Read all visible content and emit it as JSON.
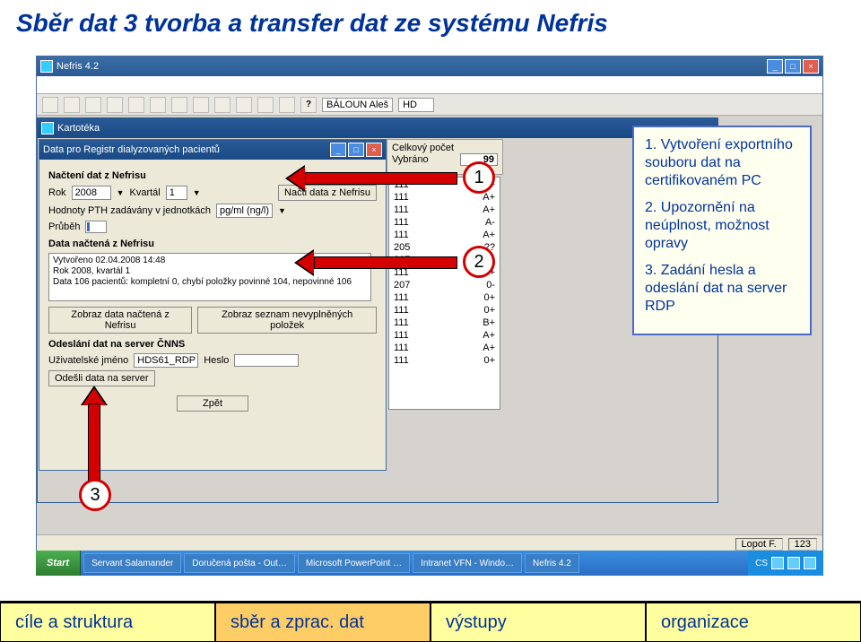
{
  "slide_title": "Sběr dat 3 tvorba a transfer dat ze systému Nefris",
  "app": {
    "title": "Nefris 4.2",
    "toolbar": {
      "help_icon": "?",
      "name_field": "BÁLOUN Aleš",
      "mode_field": "HD"
    }
  },
  "kartoteka": {
    "title": "Kartotéka"
  },
  "total": {
    "label1": "Celkový počet",
    "label2": "Vybráno",
    "value": "99"
  },
  "patients": [
    {
      "id": "111",
      "bg": "B+"
    },
    {
      "id": "111",
      "bg": "A+"
    },
    {
      "id": "111",
      "bg": "A+"
    },
    {
      "id": "111",
      "bg": "A-"
    },
    {
      "id": "111",
      "bg": "A+"
    },
    {
      "id": "205",
      "bg": "??"
    },
    {
      "id": "207",
      "bg": "AB-"
    },
    {
      "id": "111",
      "bg": "0+"
    },
    {
      "id": "207",
      "bg": "0-"
    },
    {
      "id": "111",
      "bg": "0+"
    },
    {
      "id": "111",
      "bg": "0+"
    },
    {
      "id": "111",
      "bg": "B+"
    },
    {
      "id": "111",
      "bg": "A+"
    },
    {
      "id": "111",
      "bg": "A+"
    },
    {
      "id": "111",
      "bg": "0+"
    }
  ],
  "dialog": {
    "title": "Data pro Registr dialyzovaných pacientů",
    "s1": "Načtení dat z Nefrisu",
    "rok_label": "Rok",
    "rok": "2008",
    "kvartal_label": "Kvartál",
    "kvartal": "1",
    "btn_load": "Načti data z Nefrisu",
    "pth_label": "Hodnoty PTH zadávány v jednotkách",
    "pth_unit": "pg/ml (ng/l)",
    "prubeh_label": "Průběh",
    "s2": "Data načtená z Nefrisu",
    "log1": "Vytvořeno 02.04.2008 14:48",
    "log2": "Rok 2008, kvartál 1",
    "log3": "Data 106 pacientů: kompletní 0, chybí položky povinné 104, nepovinné 106",
    "btn_show_loaded": "Zobraz data načtená z Nefrisu",
    "btn_show_missing": "Zobraz seznam nevyplněných položek",
    "s3": "Odeslání dat na server ČNNS",
    "user_label": "Uživatelské jméno",
    "user": "HDS61_RDP",
    "pass_label": "Heslo",
    "pass": "",
    "btn_send": "Odešli data na server",
    "btn_back": "Zpět"
  },
  "statusbar": {
    "user": "Lopot F.",
    "num": "123"
  },
  "taskbar": {
    "start": "Start",
    "items": [
      "Servant Salamander",
      "Doručená pošta - Out…",
      "Microsoft PowerPoint …",
      "Intranet VFN - Windo…",
      "Nefris 4.2"
    ],
    "lang": "CS"
  },
  "callouts": {
    "n1": "1. Vytvoření exportního souboru dat na certifikovaném PC",
    "n2": "2. Upozornění na neúplnost, možnost opravy",
    "n3": "3. Zadání hesla a odeslání dat na server RDP"
  },
  "labels": {
    "l1": "1",
    "l2": "2",
    "l3": "3"
  },
  "footer": {
    "t1": "cíle a struktura",
    "t2": "sběr a zprac. dat",
    "t3": "výstupy",
    "t4": "organizace"
  }
}
